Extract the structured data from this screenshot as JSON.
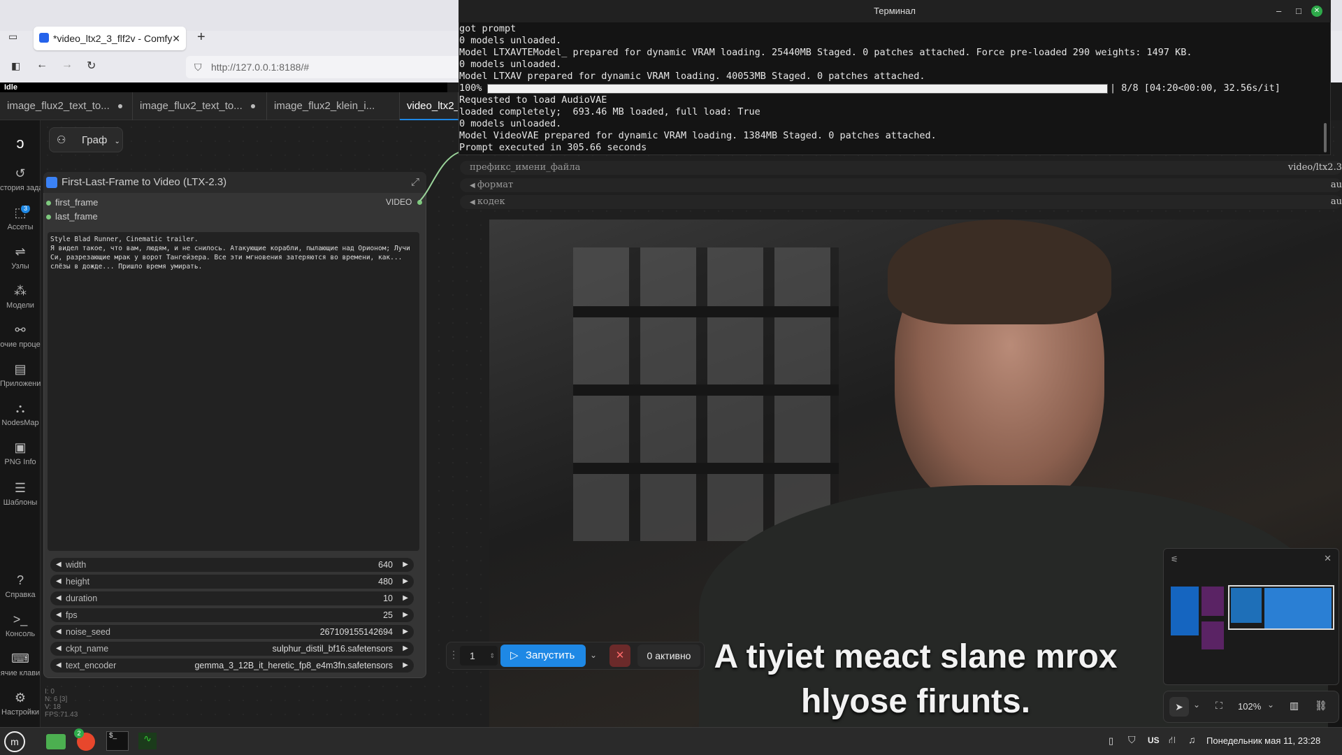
{
  "browser": {
    "tab_title": "*video_ltx2_3_flf2v - Comfy",
    "url": "http://127.0.0.1:8188/#",
    "status": "Idle"
  },
  "workflow_tabs": [
    {
      "label": "image_flux2_text_to..."
    },
    {
      "label": "image_flux2_text_to..."
    },
    {
      "label": "image_flux2_klein_i..."
    },
    {
      "label": "video_ltx2_"
    }
  ],
  "graph_button": "Граф",
  "sidebar": {
    "items": [
      {
        "label": "стория зада",
        "icon": "history-icon"
      },
      {
        "label": "Ассеты",
        "icon": "assets-icon",
        "badge": "3"
      },
      {
        "label": "Узлы",
        "icon": "nodes-icon"
      },
      {
        "label": "Модели",
        "icon": "models-icon"
      },
      {
        "label": "очие проце",
        "icon": "workflows-icon"
      },
      {
        "label": "Приложения",
        "icon": "apps-icon"
      },
      {
        "label": "NodesMap",
        "icon": "nodesmap-icon"
      },
      {
        "label": "PNG Info",
        "icon": "png-info-icon"
      },
      {
        "label": "Шаблоны",
        "icon": "templates-icon"
      },
      {
        "label": "Справка",
        "icon": "help-icon"
      },
      {
        "label": "Консоль",
        "icon": "console-icon"
      },
      {
        "label": "ячие клави",
        "icon": "keyboard-icon"
      },
      {
        "label": "Настройки",
        "icon": "settings-icon"
      }
    ]
  },
  "node": {
    "title": "First-Last-Frame to Video (LTX-2.3)",
    "inputs": [
      "first_frame",
      "last_frame"
    ],
    "output": "VIDEO",
    "prompt": "Style Blad Runner, Cinematic trailer.\nЯ видел такое, что вам, людям, и не снилось. Атакующие корабли, пылающие над Орионом; Лучи Си, разрезающие мрак у ворот Тангейзера. Все эти мгновения затеряются во времени, как... слёзы в дожде... Пришло время умирать.",
    "widgets": [
      {
        "label": "width",
        "value": "640"
      },
      {
        "label": "height",
        "value": "480"
      },
      {
        "label": "duration",
        "value": "10"
      },
      {
        "label": "fps",
        "value": "25"
      },
      {
        "label": "noise_seed",
        "value": "267109155142694"
      },
      {
        "label": "ckpt_name",
        "value": "sulphur_distil_bf16.safetensors"
      },
      {
        "label": "text_encoder",
        "value": "gemma_3_12B_it_heretic_fp8_e4m3fn.safetensors"
      }
    ]
  },
  "stats": [
    "I: 0",
    "N: 6 [3]",
    "V: 18",
    "FPS:71.43"
  ],
  "terminal": {
    "title": "Терминал",
    "lines": [
      "got prompt",
      "0 models unloaded.",
      "Model LTXAVTEModel_ prepared for dynamic VRAM loading. 25440MB Staged. 0 patches attached. Force pre-loaded 290 weights: 1497 KB.",
      "0 models unloaded.",
      "Model LTXAV prepared for dynamic VRAM loading. 40053MB Staged. 0 patches attached.",
      "Requested to load AudioVAE",
      "loaded completely;  693.46 MB loaded, full load: True",
      "0 models unloaded.",
      "Model VideoVAE prepared for dynamic VRAM loading. 1384MB Staged. 0 patches attached.",
      "Prompt executed in 305.66 seconds"
    ],
    "progress_pct": "100%",
    "progress_fraction": 1.0,
    "progress_suffix": "| 8/8 [04:20<00:00, 32.56s/it]"
  },
  "save_widgets": [
    {
      "label": "префикс_имени_файла",
      "value": "video/ltx2.3"
    },
    {
      "label": "формат",
      "value": "au"
    },
    {
      "label": "кодек",
      "value": "au"
    }
  ],
  "video": {
    "subtitle_line1": "A tiyiet meact slane mrox",
    "subtitle_line2": "hlyose firunts."
  },
  "runbar": {
    "count": "1",
    "run_label": "Запустить",
    "active_label": "0 активно"
  },
  "zoom": "102%",
  "taskbar": {
    "lang": "US",
    "datetime": "Понедельник мая 11, 23:28",
    "badge": "2"
  },
  "colors": {
    "accent": "#1e88e5",
    "cancel": "#c0392b",
    "term_bg": "#141414"
  }
}
